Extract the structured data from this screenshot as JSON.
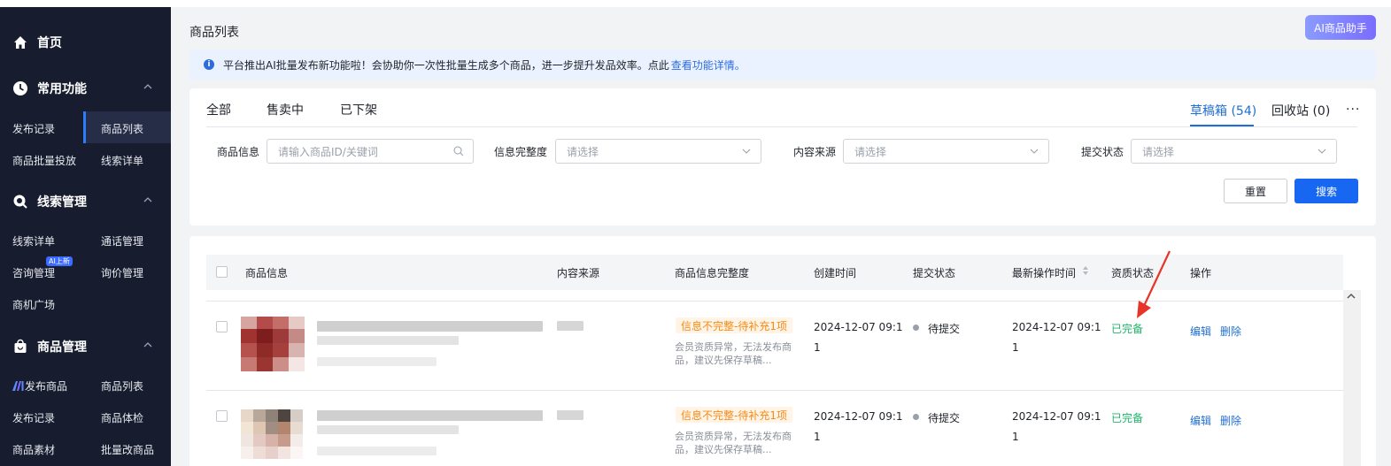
{
  "sidebar": {
    "home": "首页",
    "sections": [
      {
        "title": "常用功能",
        "items": [
          "发布记录",
          "商品列表",
          "商品批量投放",
          "线索详单"
        ]
      },
      {
        "title": "线索管理",
        "items": [
          "线索详单",
          "通话管理",
          "咨询管理",
          "询价管理",
          "商机广场"
        ],
        "badge": "AI上新"
      },
      {
        "title": "商品管理",
        "items": [
          "发布商品",
          "商品列表",
          "发布记录",
          "商品体检",
          "商品素材",
          "批量改商品"
        ]
      }
    ]
  },
  "header": {
    "page_title": "商品列表",
    "ai_button": "AI商品助手"
  },
  "notice": {
    "text": "平台推出AI批量发布新功能啦！会协助你一次性批量生成多个商品，进一步提升发品效率。点此",
    "link": "查看功能详情。"
  },
  "tabs": {
    "left": [
      "全部",
      "售卖中",
      "已下架"
    ],
    "drafts": "草稿箱 (54)",
    "recycle": "回收站 (0)",
    "more": "···"
  },
  "filters": {
    "product_info_label": "商品信息",
    "product_info_placeholder": "请输入商品ID/关键词",
    "completeness_label": "信息完整度",
    "completeness_value": "请选择",
    "source_label": "内容来源",
    "source_value": "请选择",
    "submit_label": "提交状态",
    "submit_value": "请选择",
    "reset": "重置",
    "search": "搜索"
  },
  "table": {
    "columns": [
      "商品信息",
      "内容来源",
      "商品信息完整度",
      "创建时间",
      "提交状态",
      "最新操作时间",
      "资质状态",
      "操作"
    ],
    "rows": [
      {
        "completeness_tag": "信息不完整-待补充1项",
        "completeness_desc": "会员资质异常，无法发布商品，建议先保存草稿...",
        "created_line1": "2024-12-07 09:1",
        "created_line2": "1",
        "submit_status": "待提交",
        "updated_line1": "2024-12-07 09:1",
        "updated_line2": "1",
        "qualification": "已完备",
        "edit": "编辑",
        "delete": "删除"
      },
      {
        "completeness_tag": "信息不完整-待补充1项",
        "completeness_desc": "会员资质异常，无法发布商品，建议先保存草稿...",
        "created_line1": "2024-12-07 09:1",
        "created_line2": "1",
        "submit_status": "待提交",
        "updated_line1": "2024-12-07 09:1",
        "updated_line2": "1",
        "qualification": "已完备",
        "edit": "编辑",
        "delete": "删除"
      }
    ]
  },
  "colors": {
    "sidebar_bg": "#171c2e",
    "primary": "#1767f3",
    "warn": "#f38b1b",
    "success": "#21b36b",
    "annotation_arrow": "#e8332a"
  }
}
